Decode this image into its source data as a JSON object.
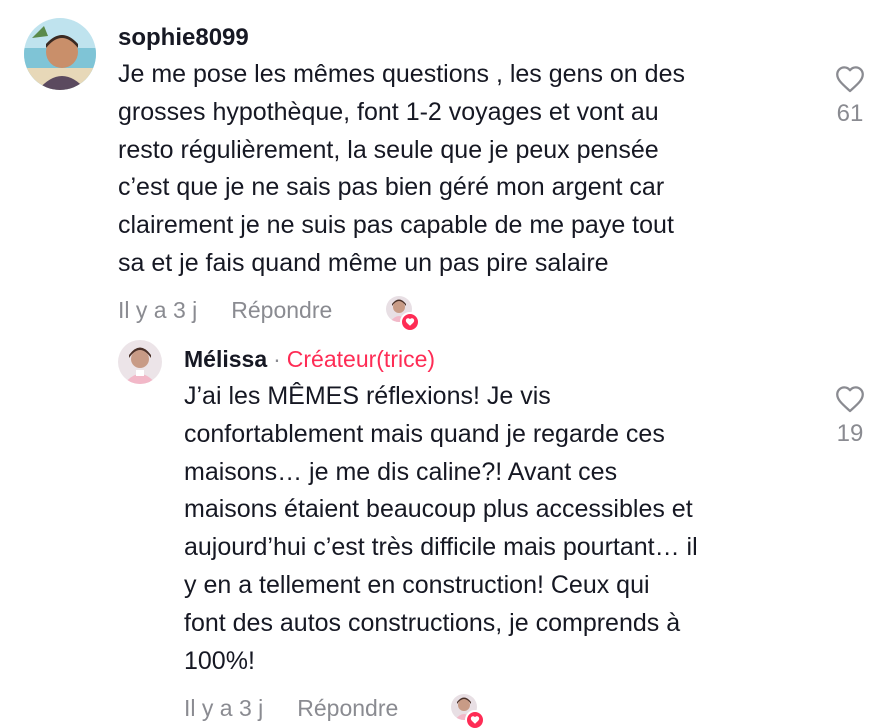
{
  "comment": {
    "username": "sophie8099",
    "lines": [
      "Je me pose les mêmes questions , les gens on des",
      "grosses hypothèque, font 1-2 voyages et vont au",
      "resto régulièrement, la seule que je peux pensée",
      "c’est que je ne sais pas bien géré mon argent car",
      "clairement je ne suis pas capable de me paye tout",
      "sa et je fais quand même un pas pire salaire"
    ],
    "time": "Il y a 3 j",
    "reply_label": "Répondre",
    "like_count": "61"
  },
  "reply": {
    "username": "Mélissa",
    "separator": "·",
    "creator_label": "Créateur(trice)",
    "lines": [
      "J’ai les MÊMES réflexions! Je vis",
      "confortablement mais quand je regarde ces",
      "maisons… je me dis caline?! Avant ces",
      "maisons étaient beaucoup plus accessibles et",
      "aujourd’hui c’est très difficile mais pourtant… il",
      "y en a tellement en construction! Ceux qui",
      "font des autos constructions, je comprends à",
      "100%!"
    ],
    "time": "Il y a 3 j",
    "reply_label": "Répondre",
    "like_count": "19"
  },
  "colors": {
    "text": "#161823",
    "secondary": "#8a8b91",
    "accent": "#fe2c55"
  },
  "icons": {
    "like": "heart-outline-icon",
    "creator_liked": "creator-liked-heart-icon"
  }
}
